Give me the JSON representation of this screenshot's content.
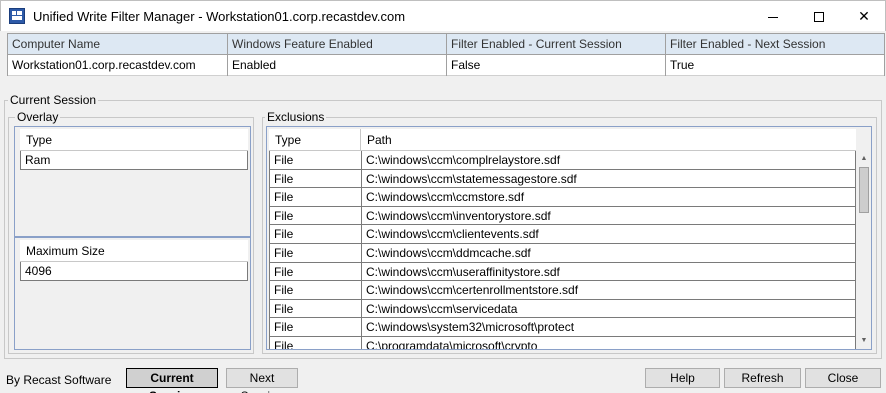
{
  "window": {
    "title": "Unified Write Filter Manager - Workstation01.corp.recastdev.com",
    "minimize_glyph": "",
    "maximize_glyph": "",
    "close_glyph": "✕"
  },
  "summary_table": {
    "columns": [
      "Computer Name",
      "Windows Feature Enabled",
      "Filter Enabled - Current Session",
      "Filter Enabled - Next Session"
    ],
    "rows": [
      [
        "Workstation01.corp.recastdev.com",
        "Enabled",
        "False",
        "True"
      ]
    ]
  },
  "current_session": {
    "label": "Current Session",
    "overlay": {
      "label": "Overlay",
      "type_header": "Type",
      "type_value": "Ram",
      "max_size_header": "Maximum Size",
      "max_size_value": "4096"
    },
    "exclusions": {
      "label": "Exclusions",
      "columns": [
        "Type",
        "Path"
      ],
      "rows": [
        [
          "File",
          "C:\\windows\\ccm\\complrelaystore.sdf"
        ],
        [
          "File",
          "C:\\windows\\ccm\\statemessagestore.sdf"
        ],
        [
          "File",
          "C:\\windows\\ccm\\ccmstore.sdf"
        ],
        [
          "File",
          "C:\\windows\\ccm\\inventorystore.sdf"
        ],
        [
          "File",
          "C:\\windows\\ccm\\clientevents.sdf"
        ],
        [
          "File",
          "C:\\windows\\ccm\\ddmcache.sdf"
        ],
        [
          "File",
          "C:\\windows\\ccm\\useraffinitystore.sdf"
        ],
        [
          "File",
          "C:\\windows\\ccm\\certenrollmentstore.sdf"
        ],
        [
          "File",
          "C:\\windows\\ccm\\servicedata"
        ],
        [
          "File",
          "C:\\windows\\system32\\microsoft\\protect"
        ],
        [
          "File",
          "C:\\programdata\\microsoft\\crypto"
        ]
      ],
      "scroll_up_glyph": "▲",
      "scroll_down_glyph": "▼"
    }
  },
  "footer": {
    "brand": "By Recast Software",
    "current_session_button": "Current Session",
    "next_session_button": "Next Session",
    "help_button": "Help",
    "refresh_button": "Refresh",
    "close_button": "Close"
  }
}
